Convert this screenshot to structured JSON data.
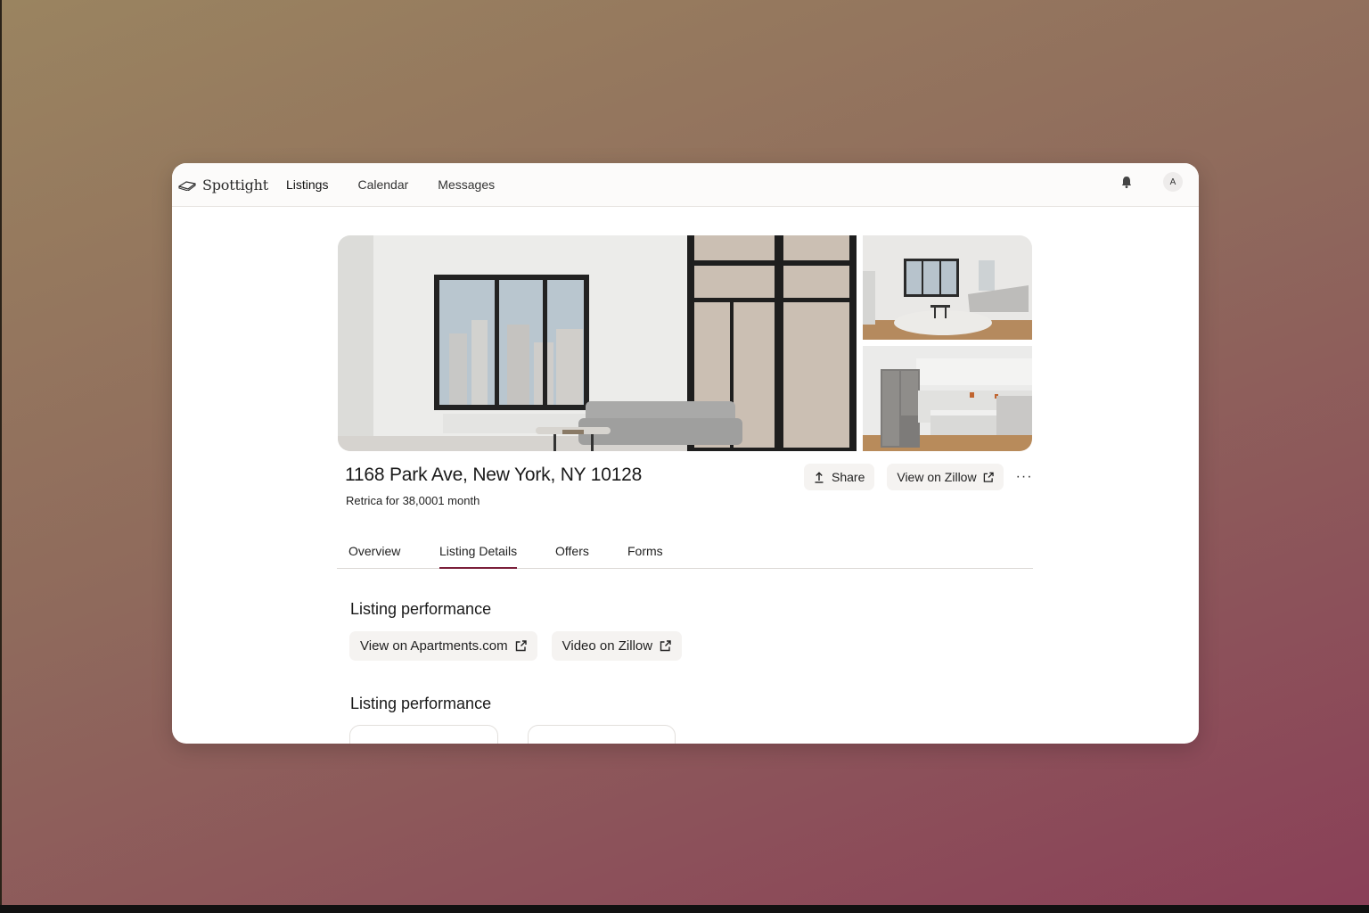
{
  "app": {
    "brand": "Spottight",
    "nav": [
      "Listings",
      "Calendar",
      "Messages"
    ],
    "avatar_initial": "A"
  },
  "listing": {
    "address": "1168 Park Ave, New York, NY 10128",
    "subtitle": "Retrica for 38,0001 month",
    "share_label": "Share",
    "zillow_label": "View on Zillow",
    "more_label": "···"
  },
  "tabs": [
    "Overview",
    "Listing Details",
    "Offers",
    "Forms"
  ],
  "active_tab": "Listing Details",
  "sections": {
    "performance_title_1": "Listing performance",
    "apartments_link": "View on Apartments.com",
    "video_link": "Video on Zillow",
    "performance_title_2": "Listing performance"
  },
  "icons": {
    "brand": "book-logo-icon",
    "bell": "bell-icon",
    "share": "upload-icon",
    "external": "external-link-icon"
  },
  "colors": {
    "accent": "#7a1f3a"
  }
}
